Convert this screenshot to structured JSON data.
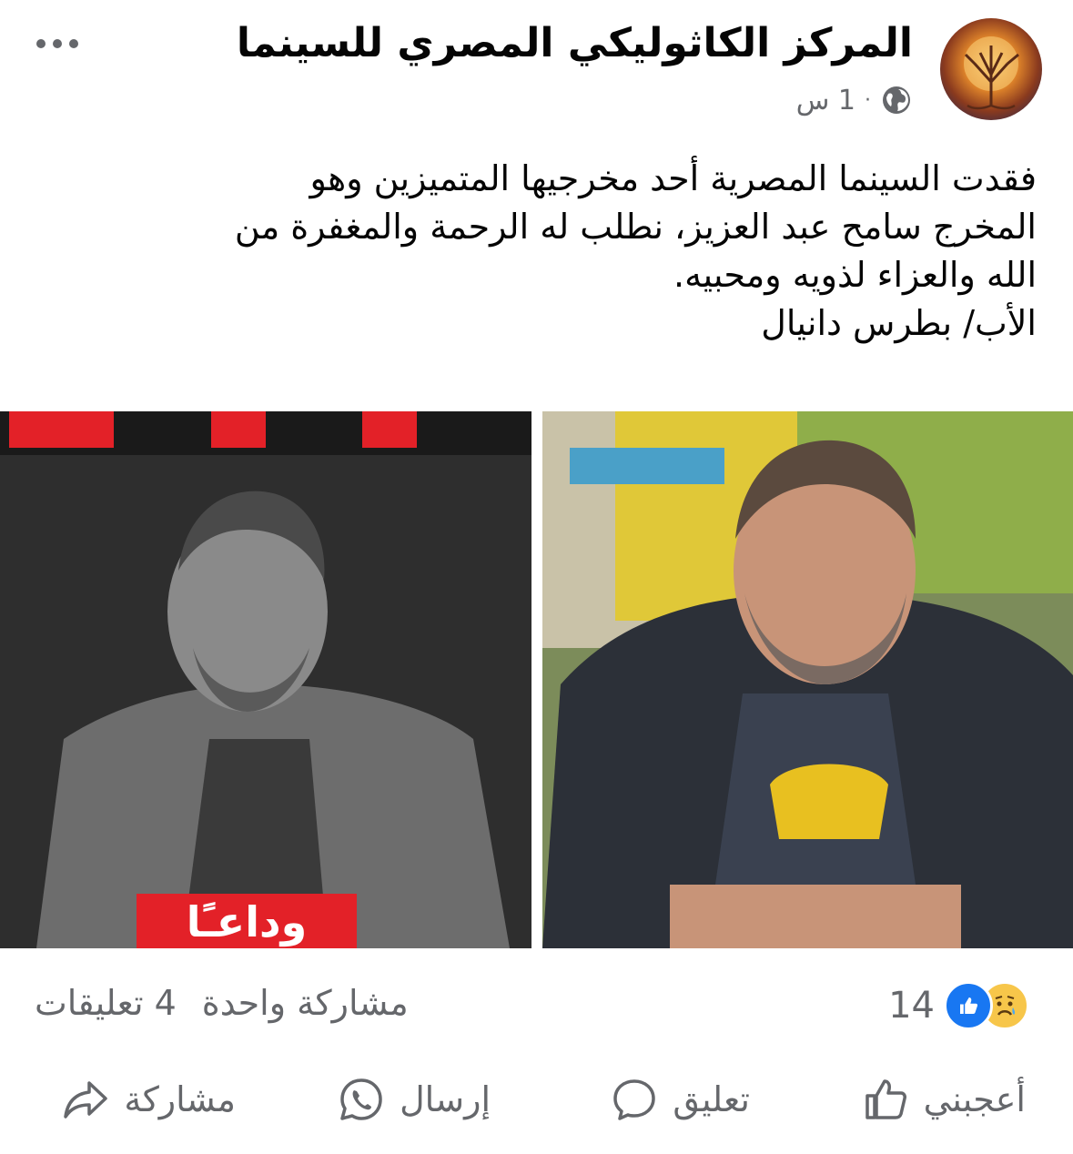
{
  "post": {
    "page_name": "المركز الكاثوليكي المصري للسينما",
    "time": "1 س",
    "separator": "·",
    "text_lines": [
      "فقدت السينما المصرية أحد مخرجيها المتميزين وهو",
      "المخرج سامح عبد العزيز، نطلب له الرحمة والمغفرة من",
      "الله والعزاء لذويه ومحبيه.",
      "الأب/ بطرس دانيال"
    ],
    "photo_left_caption": "وداعـًا"
  },
  "stats": {
    "reaction_count": "14",
    "comments": "4 تعليقات",
    "shares": "مشاركة واحدة"
  },
  "actions": {
    "like": "أعجبني",
    "comment": "تعليق",
    "send": "إرسال",
    "share": "مشاركة"
  },
  "colors": {
    "accent": "#1877f2",
    "secondary_text": "#65676b",
    "sad_reaction": "#f7c64a",
    "banner_red": "#e32128"
  }
}
